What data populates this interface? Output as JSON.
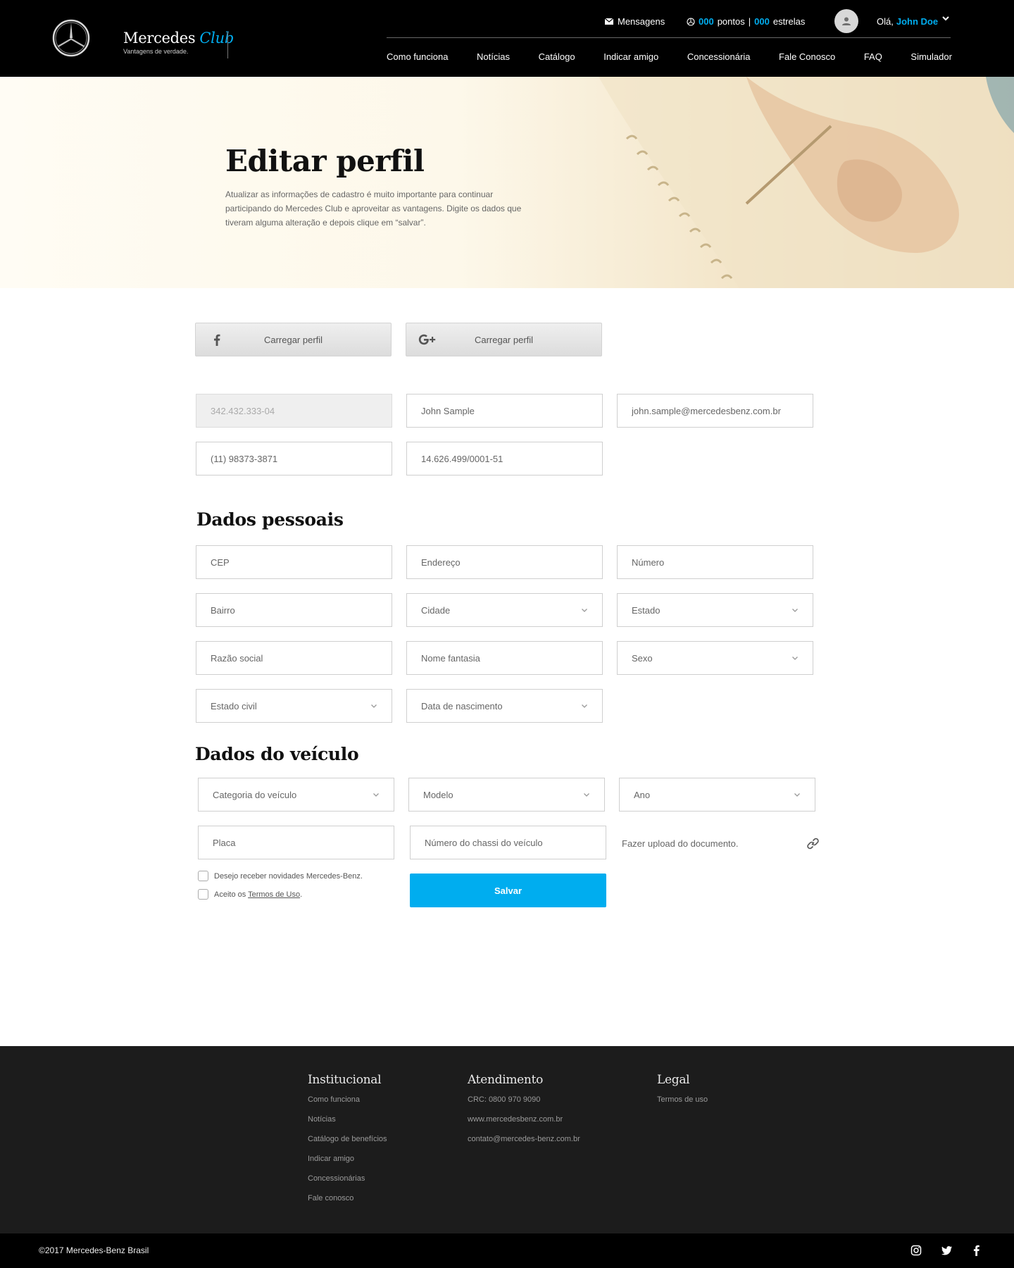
{
  "header": {
    "brand_name": "Mercedes",
    "brand_club": "Club",
    "brand_tagline": "Vantagens de verdade.",
    "messages_label": "Mensagens",
    "points_value": "000",
    "points_label": "pontos",
    "points_sep": "|",
    "stars_value": "000",
    "stars_label": "estrelas",
    "greeting": "Olá,",
    "user_name": "John Doe",
    "nav": [
      "Como funciona",
      "Notícias",
      "Catálogo",
      "Indicar amigo",
      "Concessionária",
      "Fale Conosco",
      "FAQ",
      "Simulador"
    ]
  },
  "hero": {
    "title": "Editar perfil",
    "description": "Atualizar as informações de cadastro é muito importante para continuar participando do Mercedes Club e aproveitar as vantagens. Digite os dados que tiveram alguma alteração e depois clique em “salvar”."
  },
  "social": {
    "facebook_label": "Carregar perfil",
    "google_label": "Carregar perfil"
  },
  "account": {
    "cpf": "342.432.333-04",
    "name": "John Sample",
    "email": "john.sample@mercedesbenz.com.br",
    "phone": "(11) 98373-3871",
    "cnpj": "14.626.499/0001-51"
  },
  "personal": {
    "title": "Dados pessoais",
    "cep": "CEP",
    "endereco": "Endereço",
    "numero": "Número",
    "bairro": "Bairro",
    "cidade": "Cidade",
    "estado": "Estado",
    "razao_social": "Razão social",
    "nome_fantasia": "Nome fantasia",
    "sexo": "Sexo",
    "estado_civil": "Estado civil",
    "data_nascimento": "Data de nascimento"
  },
  "vehicle": {
    "title": "Dados do veículo",
    "categoria": "Categoria do veículo",
    "modelo": "Modelo",
    "ano": "Ano",
    "placa": "Placa",
    "chassi": "Número do chassi do veículo",
    "upload": "Fazer upload do documento."
  },
  "consent": {
    "newsletter": "Desejo receber novidades Mercedes-Benz.",
    "terms_prefix": "Aceito os",
    "terms_link": "Termos de Uso",
    "terms_suffix": "."
  },
  "save_label": "Salvar",
  "footer": {
    "institucional_title": "Institucional",
    "institucional_links": [
      "Como funciona",
      "Notícias",
      "Catálogo de benefícios",
      "Indicar amigo",
      "Concessionárias",
      "Fale conosco"
    ],
    "atendimento_title": "Atendimento",
    "atendimento_links": [
      "CRC: 0800 970 9090",
      "www.mercedesbenz.com.br",
      "contato@mercedes-benz.com.br"
    ],
    "legal_title": "Legal",
    "legal_links": [
      "Termos de uso"
    ],
    "copyright": "©2017 Mercedes-Benz Brasil"
  },
  "colors": {
    "accent": "#00adef",
    "header_bg": "#000000",
    "footer_bg": "#1c1c1c"
  },
  "icons": [
    "mercedes-star-icon",
    "envelope-icon",
    "points-icon",
    "user-icon",
    "chevron-down-icon",
    "facebook-icon",
    "google-plus-icon",
    "link-icon",
    "instagram-icon",
    "twitter-icon"
  ]
}
